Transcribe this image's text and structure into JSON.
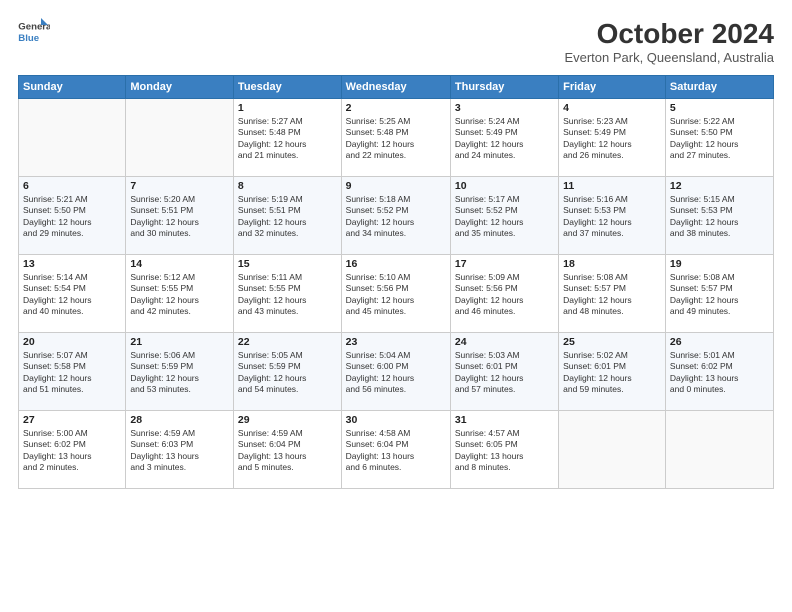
{
  "header": {
    "logo_line1": "General",
    "logo_line2": "Blue",
    "title": "October 2024",
    "location": "Everton Park, Queensland, Australia"
  },
  "days_of_week": [
    "Sunday",
    "Monday",
    "Tuesday",
    "Wednesday",
    "Thursday",
    "Friday",
    "Saturday"
  ],
  "weeks": [
    [
      {
        "day": "",
        "info": ""
      },
      {
        "day": "",
        "info": ""
      },
      {
        "day": "1",
        "info": "Sunrise: 5:27 AM\nSunset: 5:48 PM\nDaylight: 12 hours\nand 21 minutes."
      },
      {
        "day": "2",
        "info": "Sunrise: 5:25 AM\nSunset: 5:48 PM\nDaylight: 12 hours\nand 22 minutes."
      },
      {
        "day": "3",
        "info": "Sunrise: 5:24 AM\nSunset: 5:49 PM\nDaylight: 12 hours\nand 24 minutes."
      },
      {
        "day": "4",
        "info": "Sunrise: 5:23 AM\nSunset: 5:49 PM\nDaylight: 12 hours\nand 26 minutes."
      },
      {
        "day": "5",
        "info": "Sunrise: 5:22 AM\nSunset: 5:50 PM\nDaylight: 12 hours\nand 27 minutes."
      }
    ],
    [
      {
        "day": "6",
        "info": "Sunrise: 5:21 AM\nSunset: 5:50 PM\nDaylight: 12 hours\nand 29 minutes."
      },
      {
        "day": "7",
        "info": "Sunrise: 5:20 AM\nSunset: 5:51 PM\nDaylight: 12 hours\nand 30 minutes."
      },
      {
        "day": "8",
        "info": "Sunrise: 5:19 AM\nSunset: 5:51 PM\nDaylight: 12 hours\nand 32 minutes."
      },
      {
        "day": "9",
        "info": "Sunrise: 5:18 AM\nSunset: 5:52 PM\nDaylight: 12 hours\nand 34 minutes."
      },
      {
        "day": "10",
        "info": "Sunrise: 5:17 AM\nSunset: 5:52 PM\nDaylight: 12 hours\nand 35 minutes."
      },
      {
        "day": "11",
        "info": "Sunrise: 5:16 AM\nSunset: 5:53 PM\nDaylight: 12 hours\nand 37 minutes."
      },
      {
        "day": "12",
        "info": "Sunrise: 5:15 AM\nSunset: 5:53 PM\nDaylight: 12 hours\nand 38 minutes."
      }
    ],
    [
      {
        "day": "13",
        "info": "Sunrise: 5:14 AM\nSunset: 5:54 PM\nDaylight: 12 hours\nand 40 minutes."
      },
      {
        "day": "14",
        "info": "Sunrise: 5:12 AM\nSunset: 5:55 PM\nDaylight: 12 hours\nand 42 minutes."
      },
      {
        "day": "15",
        "info": "Sunrise: 5:11 AM\nSunset: 5:55 PM\nDaylight: 12 hours\nand 43 minutes."
      },
      {
        "day": "16",
        "info": "Sunrise: 5:10 AM\nSunset: 5:56 PM\nDaylight: 12 hours\nand 45 minutes."
      },
      {
        "day": "17",
        "info": "Sunrise: 5:09 AM\nSunset: 5:56 PM\nDaylight: 12 hours\nand 46 minutes."
      },
      {
        "day": "18",
        "info": "Sunrise: 5:08 AM\nSunset: 5:57 PM\nDaylight: 12 hours\nand 48 minutes."
      },
      {
        "day": "19",
        "info": "Sunrise: 5:08 AM\nSunset: 5:57 PM\nDaylight: 12 hours\nand 49 minutes."
      }
    ],
    [
      {
        "day": "20",
        "info": "Sunrise: 5:07 AM\nSunset: 5:58 PM\nDaylight: 12 hours\nand 51 minutes."
      },
      {
        "day": "21",
        "info": "Sunrise: 5:06 AM\nSunset: 5:59 PM\nDaylight: 12 hours\nand 53 minutes."
      },
      {
        "day": "22",
        "info": "Sunrise: 5:05 AM\nSunset: 5:59 PM\nDaylight: 12 hours\nand 54 minutes."
      },
      {
        "day": "23",
        "info": "Sunrise: 5:04 AM\nSunset: 6:00 PM\nDaylight: 12 hours\nand 56 minutes."
      },
      {
        "day": "24",
        "info": "Sunrise: 5:03 AM\nSunset: 6:01 PM\nDaylight: 12 hours\nand 57 minutes."
      },
      {
        "day": "25",
        "info": "Sunrise: 5:02 AM\nSunset: 6:01 PM\nDaylight: 12 hours\nand 59 minutes."
      },
      {
        "day": "26",
        "info": "Sunrise: 5:01 AM\nSunset: 6:02 PM\nDaylight: 13 hours\nand 0 minutes."
      }
    ],
    [
      {
        "day": "27",
        "info": "Sunrise: 5:00 AM\nSunset: 6:02 PM\nDaylight: 13 hours\nand 2 minutes."
      },
      {
        "day": "28",
        "info": "Sunrise: 4:59 AM\nSunset: 6:03 PM\nDaylight: 13 hours\nand 3 minutes."
      },
      {
        "day": "29",
        "info": "Sunrise: 4:59 AM\nSunset: 6:04 PM\nDaylight: 13 hours\nand 5 minutes."
      },
      {
        "day": "30",
        "info": "Sunrise: 4:58 AM\nSunset: 6:04 PM\nDaylight: 13 hours\nand 6 minutes."
      },
      {
        "day": "31",
        "info": "Sunrise: 4:57 AM\nSunset: 6:05 PM\nDaylight: 13 hours\nand 8 minutes."
      },
      {
        "day": "",
        "info": ""
      },
      {
        "day": "",
        "info": ""
      }
    ]
  ]
}
